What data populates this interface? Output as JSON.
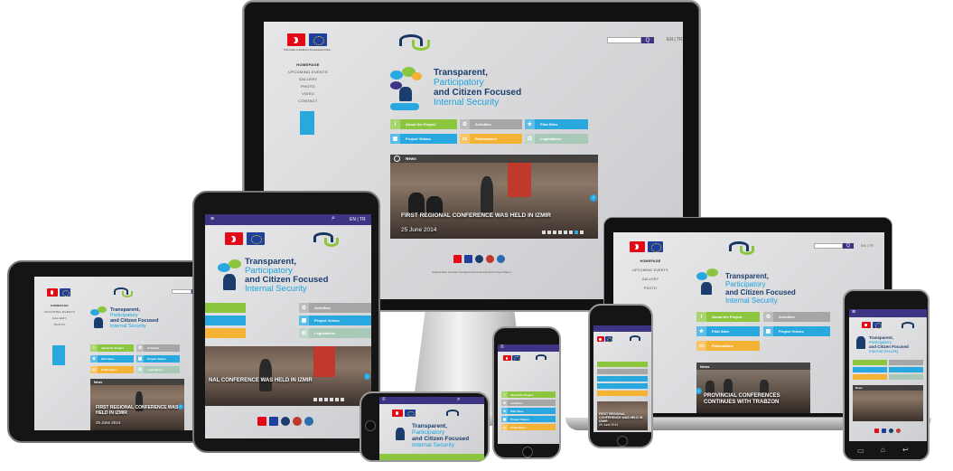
{
  "site": {
    "funding_note": "This project is funded by the European Union",
    "search_button": "Q",
    "lang": "EN | TR",
    "nav": [
      "HOMEPAGE",
      "UPCOMING EVENTS",
      "GALLERY",
      "PHOTO",
      "VIDEO",
      "CONTACT"
    ],
    "title_lines": [
      "Transparent,",
      "Participatory",
      "and Citizen Focused",
      "Internal Security"
    ],
    "tiles": [
      {
        "label": "About the Project",
        "color": "#8cc63f",
        "icon": "info-icon"
      },
      {
        "label": "Activities",
        "color": "#a6a6a6",
        "icon": "gear-icon"
      },
      {
        "label": "Pilot Sites",
        "color": "#29a7df",
        "icon": "star-icon"
      },
      {
        "label": "Project Videos",
        "color": "#29a7df",
        "icon": "video-icon"
      },
      {
        "label": "Publications",
        "color": "#f5b335",
        "icon": "book-icon"
      },
      {
        "label": "Legislations",
        "color": "#a8c8b8",
        "icon": "scales-icon"
      }
    ],
    "news_header": "News",
    "news_items": [
      {
        "caption": "FIRST REGIONAL CONFERENCE WAS HELD IN IZMIR",
        "date": "25 June 2014"
      },
      {
        "caption": "PROVINCIAL CONFERENCES CONTINUES WITH TRABZON",
        "date": ""
      },
      {
        "caption": "FIRST REGIONAL CONFERENCE WAS HELD IN IZMIR",
        "date": "25 June 2014"
      },
      {
        "caption": "NAL CONFERENCE WAS HELD IN IZMIR",
        "date": ""
      }
    ],
    "footer_text": "Implementation of Civilian Oversight of Internal Security Sector Project Phase II",
    "colors": {
      "purple": "#3d3584",
      "green": "#8cc63f",
      "blue": "#29a7df",
      "orange": "#f5b335",
      "navy": "#1b3d6d"
    }
  }
}
